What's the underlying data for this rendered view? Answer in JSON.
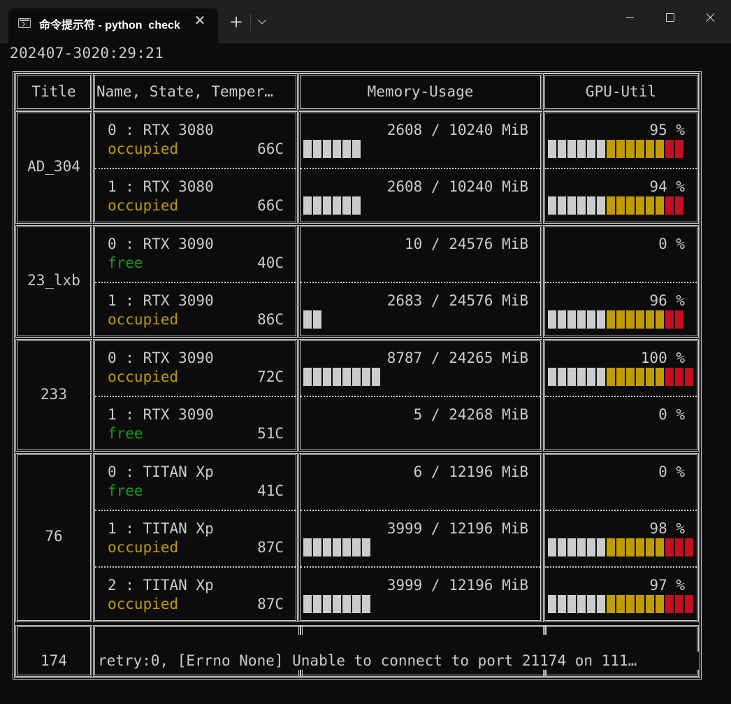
{
  "window": {
    "tab_title": "命令提示符 - python  check",
    "new_tab": "+"
  },
  "timestamp": "202407-3020:29:21",
  "table": {
    "headers": [
      "Title",
      "Name, State, Temper…",
      "Memory-Usage",
      "GPU-Util"
    ],
    "groups": [
      {
        "title": "AD_304",
        "gpus": [
          {
            "name": "0 : RTX 3080",
            "state": "occupied",
            "temp": "66C",
            "memory": "2608 / 10240 MiB",
            "mem_fraction": 0.2547,
            "util": "95 %",
            "util_value": 95
          },
          {
            "name": "1 : RTX 3080",
            "state": "occupied",
            "temp": "66C",
            "memory": "2608 / 10240 MiB",
            "mem_fraction": 0.2547,
            "util": "94 %",
            "util_value": 94
          }
        ]
      },
      {
        "title": "23_lxb",
        "gpus": [
          {
            "name": "0 : RTX 3090",
            "state": "free",
            "temp": "40C",
            "memory": "10 / 24576 MiB",
            "mem_fraction": 0.0004,
            "util": "0 %",
            "util_value": 0
          },
          {
            "name": "1 : RTX 3090",
            "state": "occupied",
            "temp": "86C",
            "memory": "2683 / 24576 MiB",
            "mem_fraction": 0.1092,
            "util": "96 %",
            "util_value": 96
          }
        ]
      },
      {
        "title": "233",
        "gpus": [
          {
            "name": "0 : RTX 3090",
            "state": "occupied",
            "temp": "72C",
            "memory": "8787 / 24265 MiB",
            "mem_fraction": 0.3621,
            "util": "100 %",
            "util_value": 100
          },
          {
            "name": "1 : RTX 3090",
            "state": "free",
            "temp": "51C",
            "memory": "5 / 24268 MiB",
            "mem_fraction": 0.0002,
            "util": "0 %",
            "util_value": 0
          }
        ]
      },
      {
        "title": "76",
        "gpus": [
          {
            "name": "0 : TITAN Xp",
            "state": "free",
            "temp": "41C",
            "memory": "6 / 12196 MiB",
            "mem_fraction": 0.0005,
            "util": "0 %",
            "util_value": 0
          },
          {
            "name": "1 : TITAN Xp",
            "state": "occupied",
            "temp": "87C",
            "memory": "3999 / 12196 MiB",
            "mem_fraction": 0.3279,
            "util": "98 %",
            "util_value": 98
          },
          {
            "name": "2 : TITAN Xp",
            "state": "occupied",
            "temp": "87C",
            "memory": "3999 / 12196 MiB",
            "mem_fraction": 0.3279,
            "util": "97 %",
            "util_value": 97
          }
        ]
      }
    ],
    "error_row": {
      "title": "174",
      "message": "retry:0, [Errno None] Unable to connect to port 21174 on 111…"
    }
  },
  "colors": {
    "occupied": "#c19c00",
    "free": "#13a10e",
    "bar_grey": "#cccccc",
    "bar_yellow": "#c19c00",
    "bar_red": "#c50f1f",
    "background": "#0c0c0c",
    "foreground": "#cccccc"
  },
  "icons": [
    "terminal-icon",
    "close-icon",
    "plus-icon",
    "chevron-down-icon",
    "minimize-icon",
    "maximize-icon",
    "window-close-icon"
  ]
}
